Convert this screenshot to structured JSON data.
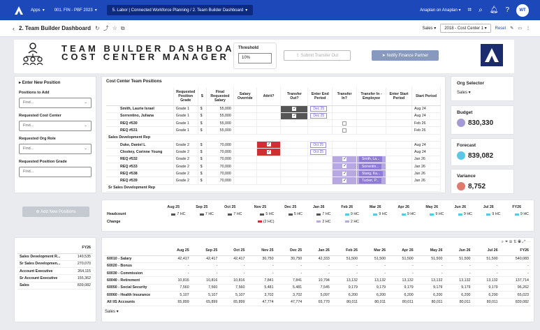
{
  "topbar": {
    "apps": "Apps",
    "model": "001. FIN - PBF 2023",
    "ctx": "5. Labor | Connected Workforce Planning / 2. Team Builder Dashboard",
    "workspace": "Anaplan on Anaplan",
    "avatar": "WT"
  },
  "subbar": {
    "title": "2. Team Builder Dashboard",
    "sales": "Sales",
    "cc": "2018 - Cost Center 1",
    "reset": "Reset"
  },
  "header": {
    "line1": "TEAM BUILDER DASHBOARD",
    "line2": "COST CENTER MANAGER",
    "threshold_label": "Threshold",
    "threshold_value": "10%",
    "submit": "Submit Transfer Out",
    "notify": "Notify Finance Partner"
  },
  "left": {
    "title": "Enter New Position",
    "positions": "Positions to Add",
    "find": "Find...",
    "req_cc": "Requested Cost Center",
    "req_org": "Requested Org Role",
    "req_grade": "Requested Position Grade",
    "add_btn": "Add New Positions"
  },
  "team": {
    "title": "Cost Center Team Positions",
    "cols": [
      "",
      "Requested Position Grade",
      "$",
      "Final Requested Salary",
      "Salary Override",
      "Attrit?",
      "Transfer Out?",
      "Enter End Period",
      "Transfer In?",
      "Transfer In - Employee",
      "Enter Start Period",
      "Start Period"
    ],
    "rows": [
      {
        "name": "Smith, Laurie Israel",
        "grade": "Grade 1",
        "cur": "$",
        "sal": "55,000",
        "attrit": "",
        "tout": "on",
        "end": "Dec 25",
        "tin": "",
        "emp": "",
        "sp": "Aug 24"
      },
      {
        "name": "Sorrentino, Juliana",
        "grade": "Grade 1",
        "cur": "$",
        "sal": "55,000",
        "attrit": "",
        "tout": "on",
        "end": "Dec 25",
        "tin": "",
        "emp": "",
        "sp": "Aug 24"
      },
      {
        "name": "REQ #530",
        "grade": "Grade 1",
        "cur": "$",
        "sal": "55,000",
        "attrit": "",
        "tout": "",
        "end": "",
        "tin": "box",
        "emp": "",
        "sp": "Feb 26"
      },
      {
        "name": "REQ #531",
        "grade": "Grade 1",
        "cur": "$",
        "sal": "55,000",
        "attrit": "",
        "tout": "",
        "end": "",
        "tin": "box",
        "emp": "",
        "sp": "Feb 26"
      },
      {
        "section": "Sales Development Rep"
      },
      {
        "name": "Duke, Daniel L",
        "grade": "Grade 2",
        "cur": "$",
        "sal": "70,000",
        "attrit": "on",
        "tout": "",
        "end": "Oct 25",
        "tin": "",
        "emp": "",
        "sp": "Aug 24"
      },
      {
        "name": "Closkey, Corinne Young",
        "grade": "Grade 2",
        "cur": "$",
        "sal": "70,000",
        "attrit": "on",
        "tout": "",
        "end": "Oct 25",
        "tin": "",
        "emp": "",
        "sp": "Aug 24"
      },
      {
        "name": "REQ #532",
        "grade": "Grade 2",
        "cur": "$",
        "sal": "70,000",
        "attrit": "",
        "tout": "",
        "end": "",
        "tin": "on",
        "emp": "Smith, La...",
        "sp": "Jan 26"
      },
      {
        "name": "REQ #533",
        "grade": "Grade 2",
        "cur": "$",
        "sal": "70,000",
        "attrit": "",
        "tout": "",
        "end": "",
        "tin": "on",
        "emp": "Sorrentin...",
        "sp": "Jan 26"
      },
      {
        "name": "REQ #538",
        "grade": "Grade 2",
        "cur": "$",
        "sal": "70,000",
        "attrit": "",
        "tout": "",
        "end": "",
        "tin": "on",
        "emp": "Stang, Ka...",
        "sp": "Jan 26"
      },
      {
        "name": "REQ #539",
        "grade": "Grade 2",
        "cur": "$",
        "sal": "70,000",
        "attrit": "",
        "tout": "",
        "end": "",
        "tin": "on",
        "emp": "Tucker, P...",
        "sp": "Jan 26"
      },
      {
        "section": "Sr Sales Development Rep"
      }
    ]
  },
  "org": {
    "title": "Org Selector",
    "value": "Sales"
  },
  "budget": {
    "label": "Budget",
    "value": "830,330",
    "color": "#a59ad6"
  },
  "forecast": {
    "label": "Forecast",
    "value": "839,082",
    "color": "#5bc7e8"
  },
  "variance": {
    "label": "Variance",
    "value": "8,752",
    "color": "#e07a6e"
  },
  "timeline": {
    "months": [
      "Aug 25",
      "Sep 25",
      "Oct 25",
      "Nov 25",
      "Dec 25",
      "Jan 26",
      "Feb 26",
      "Mar 26",
      "Apr 26",
      "May 26",
      "Jun 26",
      "Jul 26",
      "FY26"
    ],
    "headcount_label": "Headcount",
    "change_label": "Change",
    "headcount": [
      "7 HC",
      "7 HC",
      "7 HC",
      "5 HC",
      "5 HC",
      "7 HC",
      "9 HC",
      "9 HC",
      "9 HC",
      "9 HC",
      "9 HC",
      "9 HC",
      "9 HC"
    ],
    "change": [
      "",
      "",
      "",
      "(2 HC)",
      "",
      "2 HC",
      "2 HC",
      "",
      "",
      "",
      "",
      "",
      ""
    ]
  },
  "summary": {
    "col": "FY26",
    "rows": [
      [
        "Sales Development R...",
        "149,535"
      ],
      [
        "Sr Sales Developmen...",
        "270,070"
      ],
      [
        "Account Executive",
        "264,115"
      ],
      [
        "Sr Account Executive",
        "155,362"
      ],
      [
        "Sales",
        "839,082"
      ]
    ]
  },
  "budget_table": {
    "months": [
      "Aug 25",
      "Sep 25",
      "Oct 25",
      "Nov 25",
      "Dec 25",
      "Jan 26",
      "Feb 26",
      "Mar 26",
      "Apr 26",
      "May 26",
      "Jun 26",
      "Jul 26",
      "FY26"
    ],
    "rows": [
      {
        "name": "60010 - Salary",
        "v": [
          "42,417",
          "42,417",
          "42,417",
          "30,750",
          "30,750",
          "42,333",
          "51,500",
          "51,500",
          "51,500",
          "51,500",
          "51,500",
          "51,500",
          "540,083"
        ]
      },
      {
        "name": "60020 - Bonus",
        "v": [
          "-",
          "-",
          "-",
          "-",
          "-",
          "-",
          "-",
          "-",
          "-",
          "-",
          "-",
          "-",
          "-"
        ]
      },
      {
        "name": "60030 - Commission",
        "v": [
          "-",
          "-",
          "-",
          "-",
          "-",
          "-",
          "-",
          "-",
          "-",
          "-",
          "-",
          "-",
          "-"
        ]
      },
      {
        "name": "60040 - Retirement",
        "v": [
          "10,816",
          "10,816",
          "10,816",
          "7,841",
          "7,841",
          "10,794",
          "13,132",
          "13,132",
          "13,132",
          "13,132",
          "13,132",
          "13,132",
          "137,714"
        ]
      },
      {
        "name": "60050 - Social Security",
        "v": [
          "7,560",
          "7,560",
          "7,560",
          "5,481",
          "5,481",
          "7,545",
          "9,179",
          "9,179",
          "9,179",
          "9,179",
          "9,179",
          "9,179",
          "96,262"
        ]
      },
      {
        "name": "60060 - Health Insurance",
        "v": [
          "5,107",
          "5,107",
          "5,107",
          "3,702",
          "3,702",
          "5,097",
          "6,200",
          "6,200",
          "6,200",
          "6,200",
          "6,200",
          "6,200",
          "65,023"
        ]
      },
      {
        "name": "All I/S Accounts",
        "v": [
          "65,899",
          "65,899",
          "65,899",
          "47,774",
          "47,774",
          "65,770",
          "80,011",
          "80,011",
          "80,011",
          "80,011",
          "80,011",
          "80,011",
          "839,082"
        ]
      }
    ],
    "footer": "Sales"
  }
}
